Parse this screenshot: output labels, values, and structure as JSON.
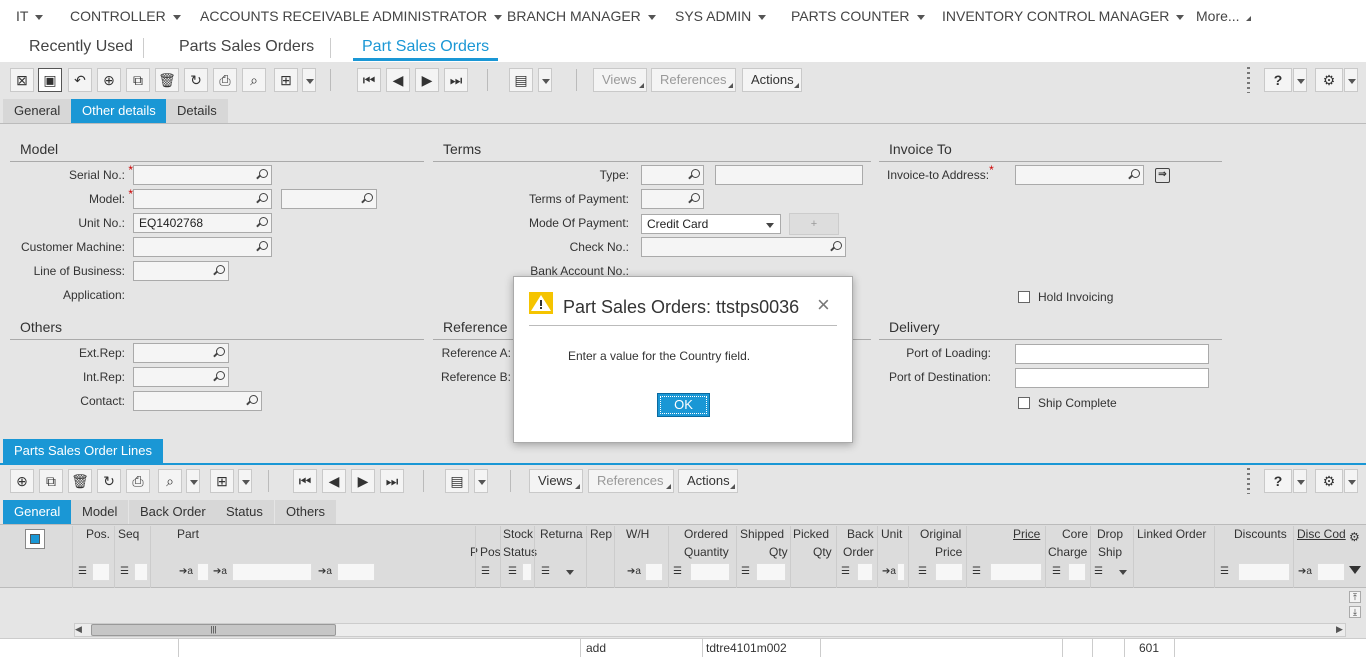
{
  "topnav": {
    "items": [
      "IT",
      "CONTROLLER",
      "ACCOUNTS RECEIVABLE ADMINISTRATOR",
      "BRANCH MANAGER",
      "SYS ADMIN",
      "PARTS COUNTER",
      "INVENTORY CONTROL MANAGER"
    ],
    "more": "More..."
  },
  "sessions": {
    "tabs": [
      "Recently Used",
      "Parts Sales Orders",
      "Part Sales Orders"
    ]
  },
  "toolbar": {
    "views": "Views",
    "references": "References",
    "actions": "Actions",
    "help": "?"
  },
  "form_tabs": [
    "General",
    "Other details",
    "Details"
  ],
  "model_section": {
    "title": "Model",
    "serial_label": "Serial No.:",
    "model_label": "Model:",
    "unit_label": "Unit No.:",
    "unit_value": "EQ1402768",
    "customer_machine_label": "Customer Machine:",
    "line_of_business_label": "Line of Business:",
    "application_label": "Application:"
  },
  "terms_section": {
    "title": "Terms",
    "type_label": "Type:",
    "terms_payment_label": "Terms of Payment:",
    "mode_payment_label": "Mode Of Payment:",
    "mode_payment_value": "Credit Card",
    "plus": "+",
    "check_label": "Check No.:",
    "bank_label": "Bank Account No.:"
  },
  "invoice_section": {
    "title": "Invoice To",
    "address_label": "Invoice-to Address:",
    "hold_invoicing": "Hold Invoicing"
  },
  "others_section": {
    "title": "Others",
    "ext_rep": "Ext.Rep:",
    "int_rep": "Int.Rep:",
    "contact": "Contact:"
  },
  "reference_section": {
    "title": "Reference",
    "ref_a": "Reference A:",
    "ref_b": "Reference B:"
  },
  "delivery_section": {
    "title": "Delivery",
    "port_loading": "Port of Loading:",
    "port_destination": "Port of Destination:",
    "ship_complete": "Ship Complete"
  },
  "dialog": {
    "title": "Part Sales Orders: ttstps0036",
    "message": "Enter a value for the Country field.",
    "ok": "OK",
    "close": "×"
  },
  "lines": {
    "tab": "Parts Sales Order Lines",
    "views": "Views",
    "references": "References",
    "actions": "Actions",
    "help": "?",
    "tabs": [
      "General",
      "Model",
      "Back Order",
      "Status",
      "Others"
    ],
    "headers": {
      "pos": "Pos.",
      "seq": "Seq",
      "part": "Part",
      "p": "P",
      "pos2": "Pos",
      "stock_status_1": "Stock",
      "stock_status_2": "Status",
      "returnable": "Returna",
      "rep": "Rep",
      "wh": "W/H",
      "ordered_1": "Ordered",
      "ordered_2": "Quantity",
      "shipped_1": "Shipped",
      "shipped_2": "Qty",
      "picked_1": "Picked",
      "picked_2": "Qty",
      "back_1": "Back",
      "back_2": "Order",
      "unit": "Unit",
      "original_1": "Original",
      "original_2": "Price",
      "price": "Price",
      "core_1": "Core",
      "core_2": "Charge",
      "drop_1": "Drop",
      "drop_2": "Ship",
      "linked": "Linked Order",
      "discounts": "Discounts",
      "disc_code": "Disc Cod"
    },
    "footer": {
      "add": "add",
      "session": "tdtre4101m002",
      "number": "601"
    }
  }
}
